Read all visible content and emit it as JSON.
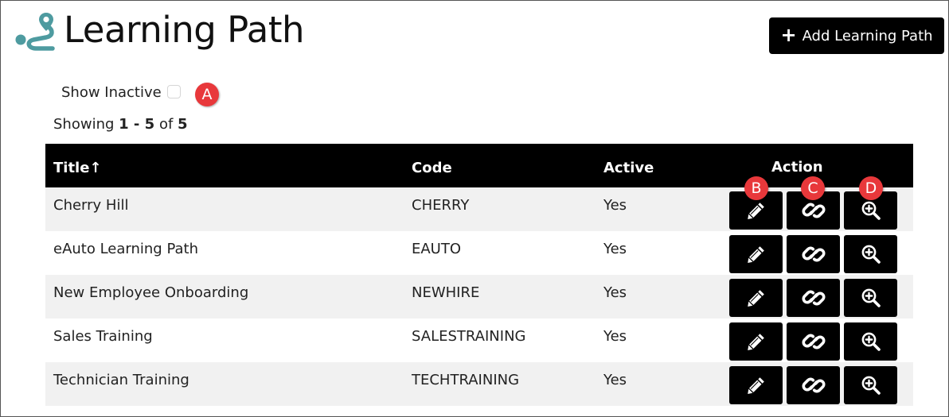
{
  "header": {
    "title": "Learning Path",
    "logo_icon": "route-path-icon",
    "logo_color": "#4e9ba0",
    "add_button_label": "Add Learning Path"
  },
  "filters": {
    "show_inactive_label": "Show Inactive",
    "show_inactive_checked": false
  },
  "showing": {
    "prefix": "Showing",
    "range": "1 - 5",
    "of_label": "of",
    "total": "5"
  },
  "table": {
    "columns": {
      "title": "Title",
      "code": "Code",
      "active": "Active",
      "action": "Action"
    },
    "sort_indicator": "↑",
    "rows": [
      {
        "title": "Cherry Hill",
        "code": "CHERRY",
        "active": "Yes"
      },
      {
        "title": "eAuto Learning Path",
        "code": "EAUTO",
        "active": "Yes"
      },
      {
        "title": "New Employee Onboarding",
        "code": "NEWHIRE",
        "active": "Yes"
      },
      {
        "title": "Sales Training",
        "code": "SALESTRAINING",
        "active": "Yes"
      },
      {
        "title": "Technician Training",
        "code": "TECHTRAINING",
        "active": "Yes"
      }
    ],
    "action_icons": [
      "pencil-icon",
      "link-icon",
      "zoom-in-icon"
    ]
  },
  "annotations": {
    "a": "A",
    "b": "B",
    "c": "C",
    "d": "D",
    "color": "#e8383b"
  }
}
